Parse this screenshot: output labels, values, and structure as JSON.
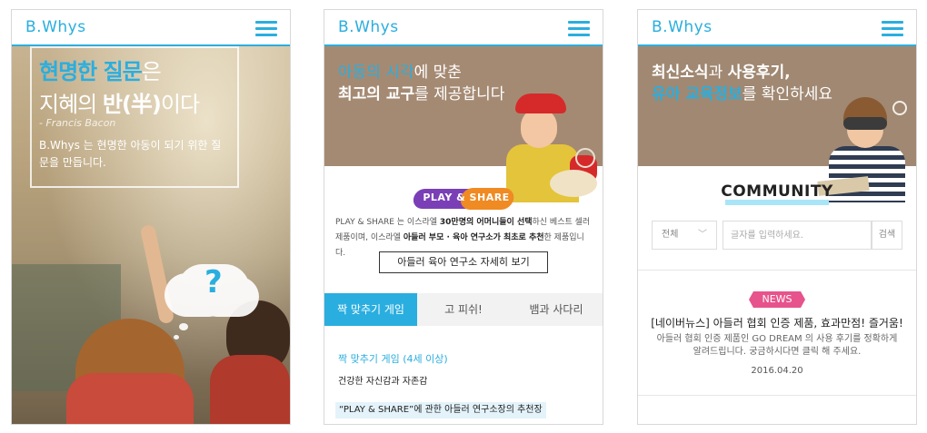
{
  "brand": {
    "logo": "B.Whys",
    "accent": "#2aaedf"
  },
  "phone1": {
    "headline_highlight": "현명한 질문",
    "headline_rest": "은",
    "line2_a": "지혜의 ",
    "line2_bold": "반(半)",
    "line2_b": "이다",
    "author": "- Francis Bacon",
    "description": "B.Whys 는 현명한 아동이 되기 위한 질문을 만듭니다.",
    "cloud_symbol": "?"
  },
  "phone2": {
    "hero_line1_highlight": "아동의 시각",
    "hero_line1_rest": "에 맞춘",
    "hero_line2_bold": "최고의 교구",
    "hero_line2_rest": "를 제공합니다",
    "badge_text": "PLAY & SHARE",
    "intro_a": "PLAY & SHARE 는 이스라엘 ",
    "intro_b1": "30만명의 어머니들이 선택",
    "intro_c": "하신 베스트 셀러 제품이며, 이스라엘 ",
    "intro_b2": "아들러 부모 · 육아 연구소가 최초로 추천",
    "intro_d": "한 제품입니다.",
    "detail_button": "아들러 육아 연구소 자세히 보기",
    "tabs": [
      "짝 맞추기 게임",
      "고 피쉬!",
      "뱀과 사다리"
    ],
    "game_title": "짝 맞추기 게임 (4세 이상)",
    "game_desc": "건강한 자신감과 자존감",
    "quote": "“PLAY & SHARE”에 관한 아들러 연구소장의 추천장"
  },
  "phone3": {
    "hero_line1_a": "최신소식",
    "hero_line1_b": "과 ",
    "hero_line1_c": "사용후기,",
    "hero_line2_highlight": "유아 교육정보",
    "hero_line2_rest": "를 확인하세요",
    "community_title": "COMMUNITY",
    "select_value": "전체",
    "search_placeholder": "글자를 입력하세요.",
    "search_button": "검색",
    "news_badge": "NEWS",
    "news_title": "[네이버뉴스] 아들러 협회 인증 제품, 효과만점! 즐거움!",
    "news_desc": "아들러 협회 인증 제품인 GO DREAM 의 사용 후기를 정확하게 알려드립니다. 궁금하시다면 클릭 해 주세요.",
    "news_date": "2016.04.20"
  }
}
